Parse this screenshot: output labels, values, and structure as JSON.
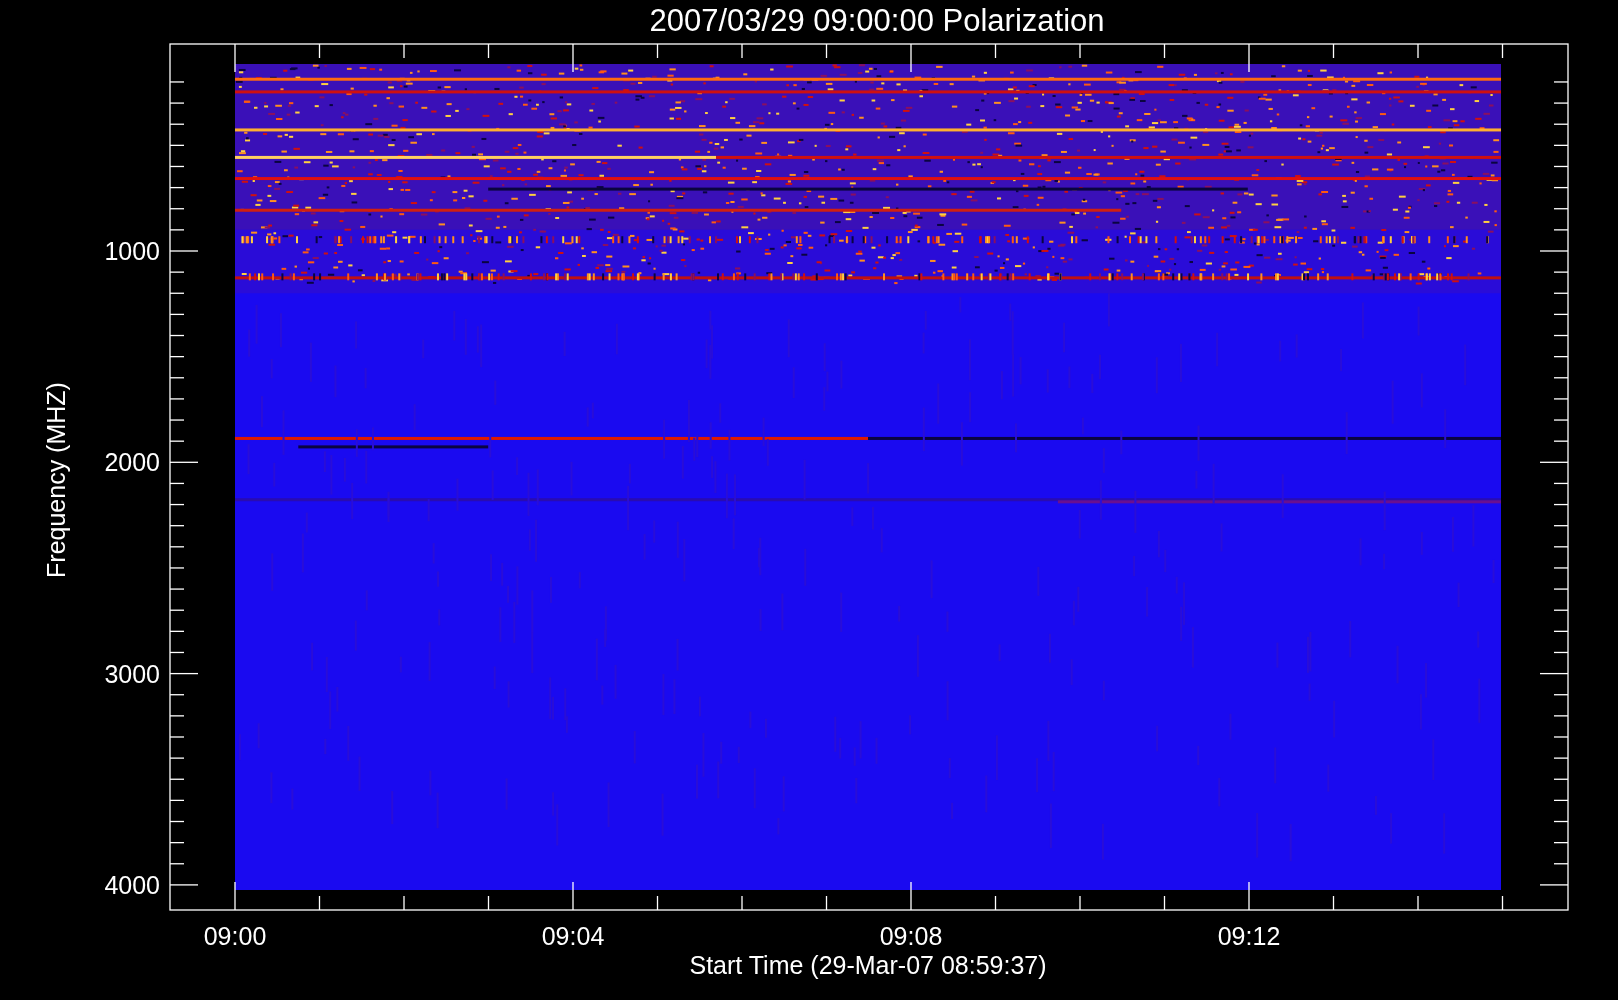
{
  "plot": {
    "title": "2007/03/29 09:00:00 Polarization",
    "y_axis": {
      "label": "Frequency (MHZ)",
      "ticks": [
        "1000",
        "2000",
        "3000",
        "4000"
      ]
    },
    "x_axis": {
      "label": "Start Time (29-Mar-07 08:59:37)",
      "ticks": [
        "09:00",
        "09:04",
        "09:08",
        "09:12"
      ]
    }
  }
}
